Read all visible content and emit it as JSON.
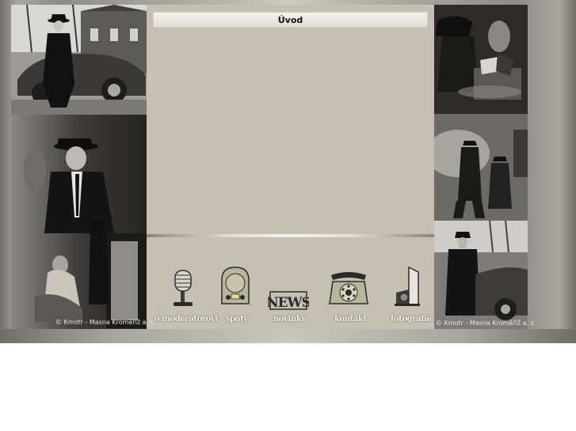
{
  "header": {
    "title": "Úvod"
  },
  "nav": {
    "items": [
      {
        "label": "o moderátorovi",
        "icon": "microphone-icon"
      },
      {
        "label": "spoty",
        "icon": "radio-icon"
      },
      {
        "label": "novinky",
        "icon": "news-icon"
      },
      {
        "label": "kontakt",
        "icon": "telephone-icon"
      },
      {
        "label": "fotografie",
        "icon": "camera-icon"
      }
    ]
  },
  "copyright": {
    "left": "© Kmotr - Masna Kroměříž a. s.",
    "right": "© Kmotr - Masna Kroměříž a. s."
  },
  "colors": {
    "panel": "#c5c0b3",
    "title_bar": "#e9e7e1",
    "nav_text": "#f4f1e8"
  }
}
